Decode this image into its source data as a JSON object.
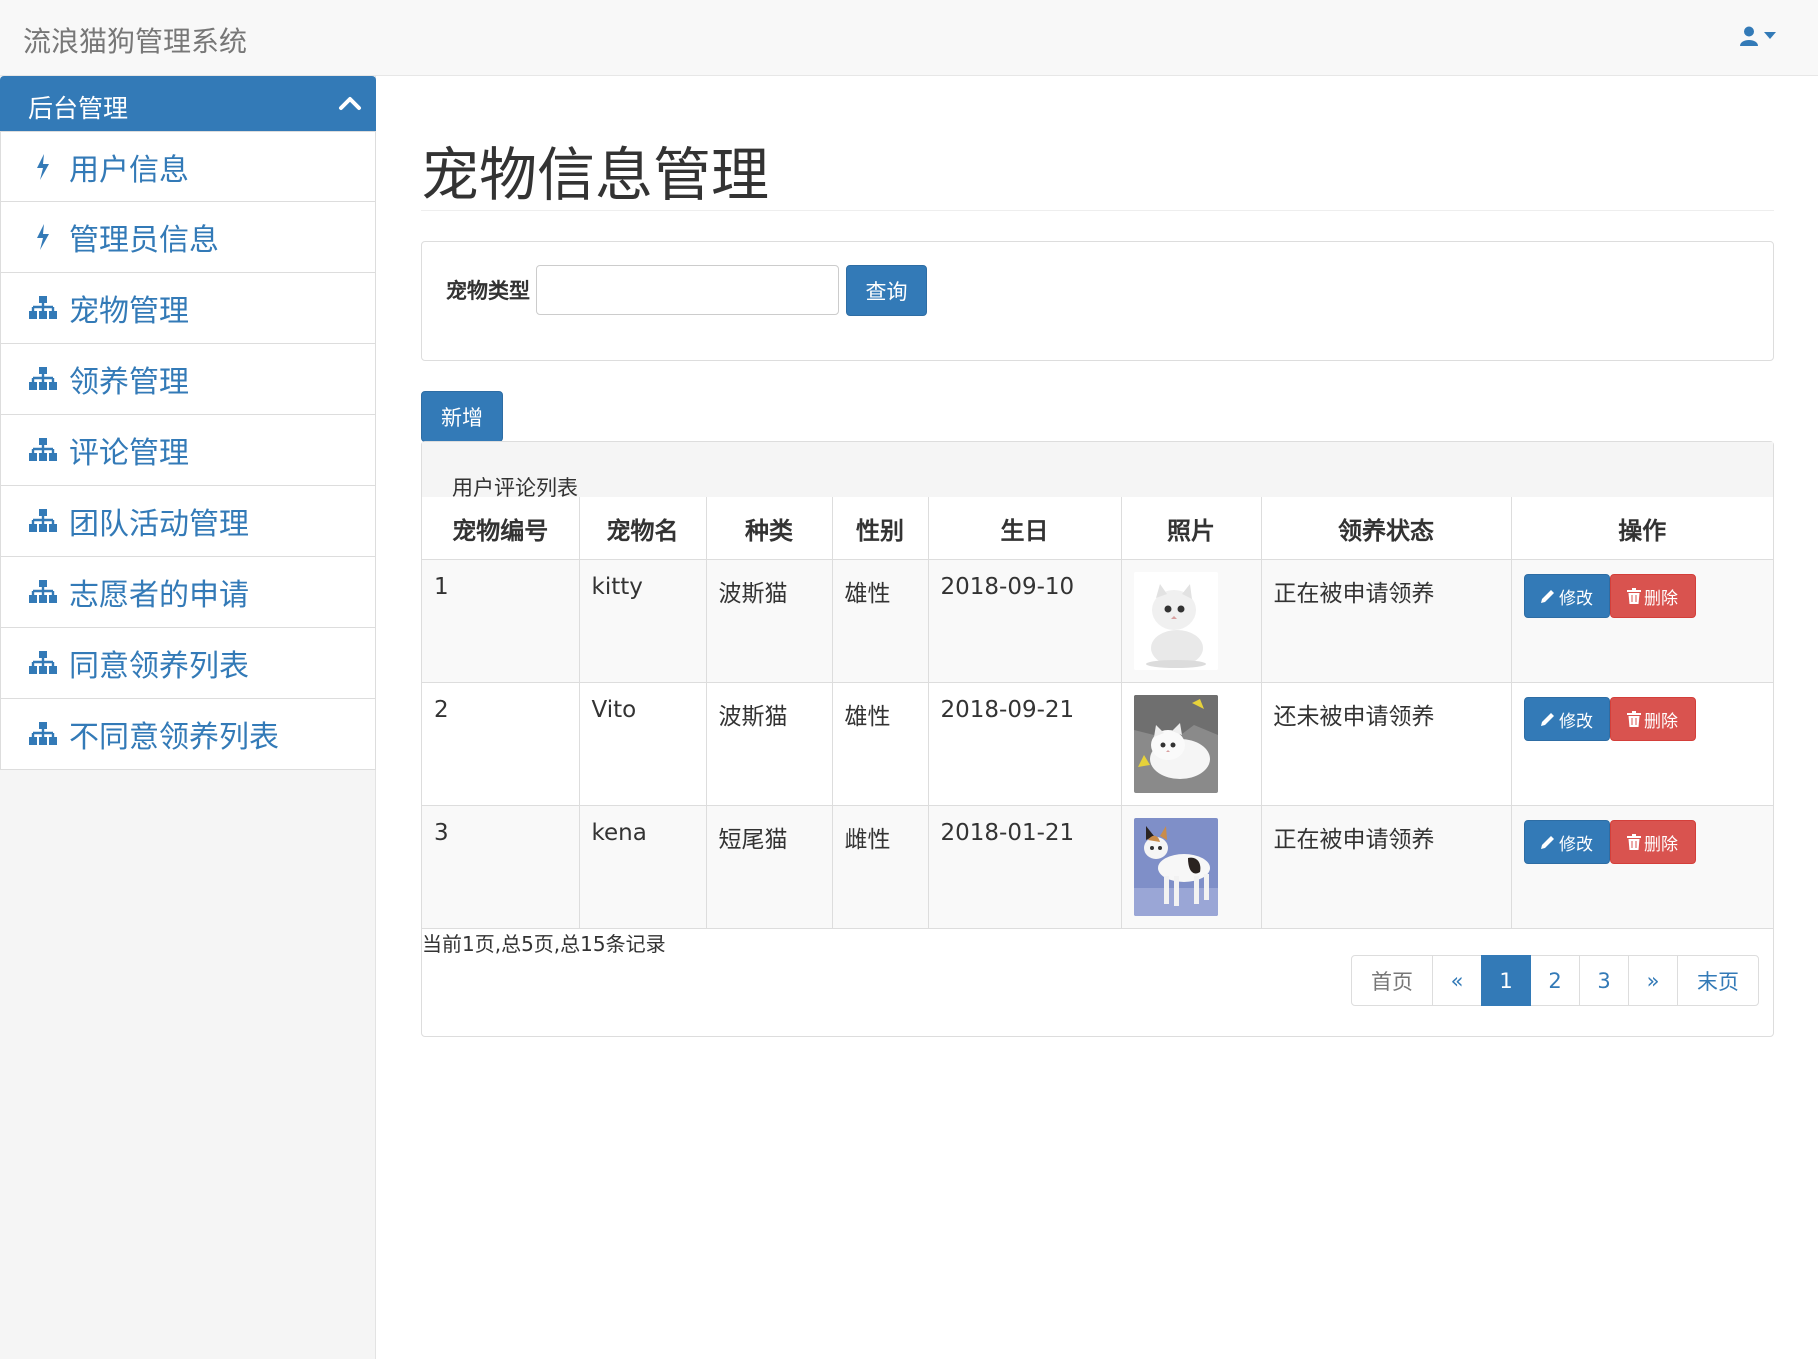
{
  "app": {
    "title": "流浪猫狗管理系统"
  },
  "sidebar": {
    "header": "后台管理",
    "items": [
      {
        "label": "用户信息",
        "icon": "bolt-icon"
      },
      {
        "label": "管理员信息",
        "icon": "bolt-icon"
      },
      {
        "label": "宠物管理",
        "icon": "sitemap-icon"
      },
      {
        "label": "领养管理",
        "icon": "sitemap-icon"
      },
      {
        "label": "评论管理",
        "icon": "sitemap-icon"
      },
      {
        "label": "团队活动管理",
        "icon": "sitemap-icon"
      },
      {
        "label": "志愿者的申请",
        "icon": "sitemap-icon"
      },
      {
        "label": "同意领养列表",
        "icon": "sitemap-icon"
      },
      {
        "label": "不同意领养列表",
        "icon": "sitemap-icon"
      }
    ]
  },
  "main": {
    "title": "宠物信息管理",
    "query": {
      "label": "宠物类型",
      "value": "",
      "button": "查询"
    },
    "add_button": "新增",
    "list_title": "用户评论列表",
    "columns": [
      "宠物编号",
      "宠物名",
      "种类",
      "性别",
      "生日",
      "照片",
      "领养状态",
      "操作"
    ],
    "rows": [
      {
        "id": "1",
        "name": "kitty",
        "kind": "波斯猫",
        "sex": "雄性",
        "birthday": "2018-09-10",
        "status": "正在被申请领养",
        "photo": "white-persian-cat"
      },
      {
        "id": "2",
        "name": "Vito",
        "kind": "波斯猫",
        "sex": "雄性",
        "birthday": "2018-09-21",
        "status": "还未被申请领养",
        "photo": "white-kitten-lying"
      },
      {
        "id": "3",
        "name": "kena",
        "kind": "短尾猫",
        "sex": "雌性",
        "birthday": "2018-01-21",
        "status": "正在被申请领养",
        "photo": "calico-bobtail-cat"
      }
    ],
    "row_actions": {
      "edit": "修改",
      "delete": "删除"
    },
    "record_info": "当前1页,总5页,总15条记录",
    "pagination": {
      "first": "首页",
      "prev": "«",
      "pages": [
        "1",
        "2",
        "3"
      ],
      "current": "1",
      "next": "»",
      "last": "末页"
    }
  },
  "colors": {
    "primary": "#337ab7",
    "danger": "#d9534f",
    "navbar_bg": "#f8f8f8"
  }
}
